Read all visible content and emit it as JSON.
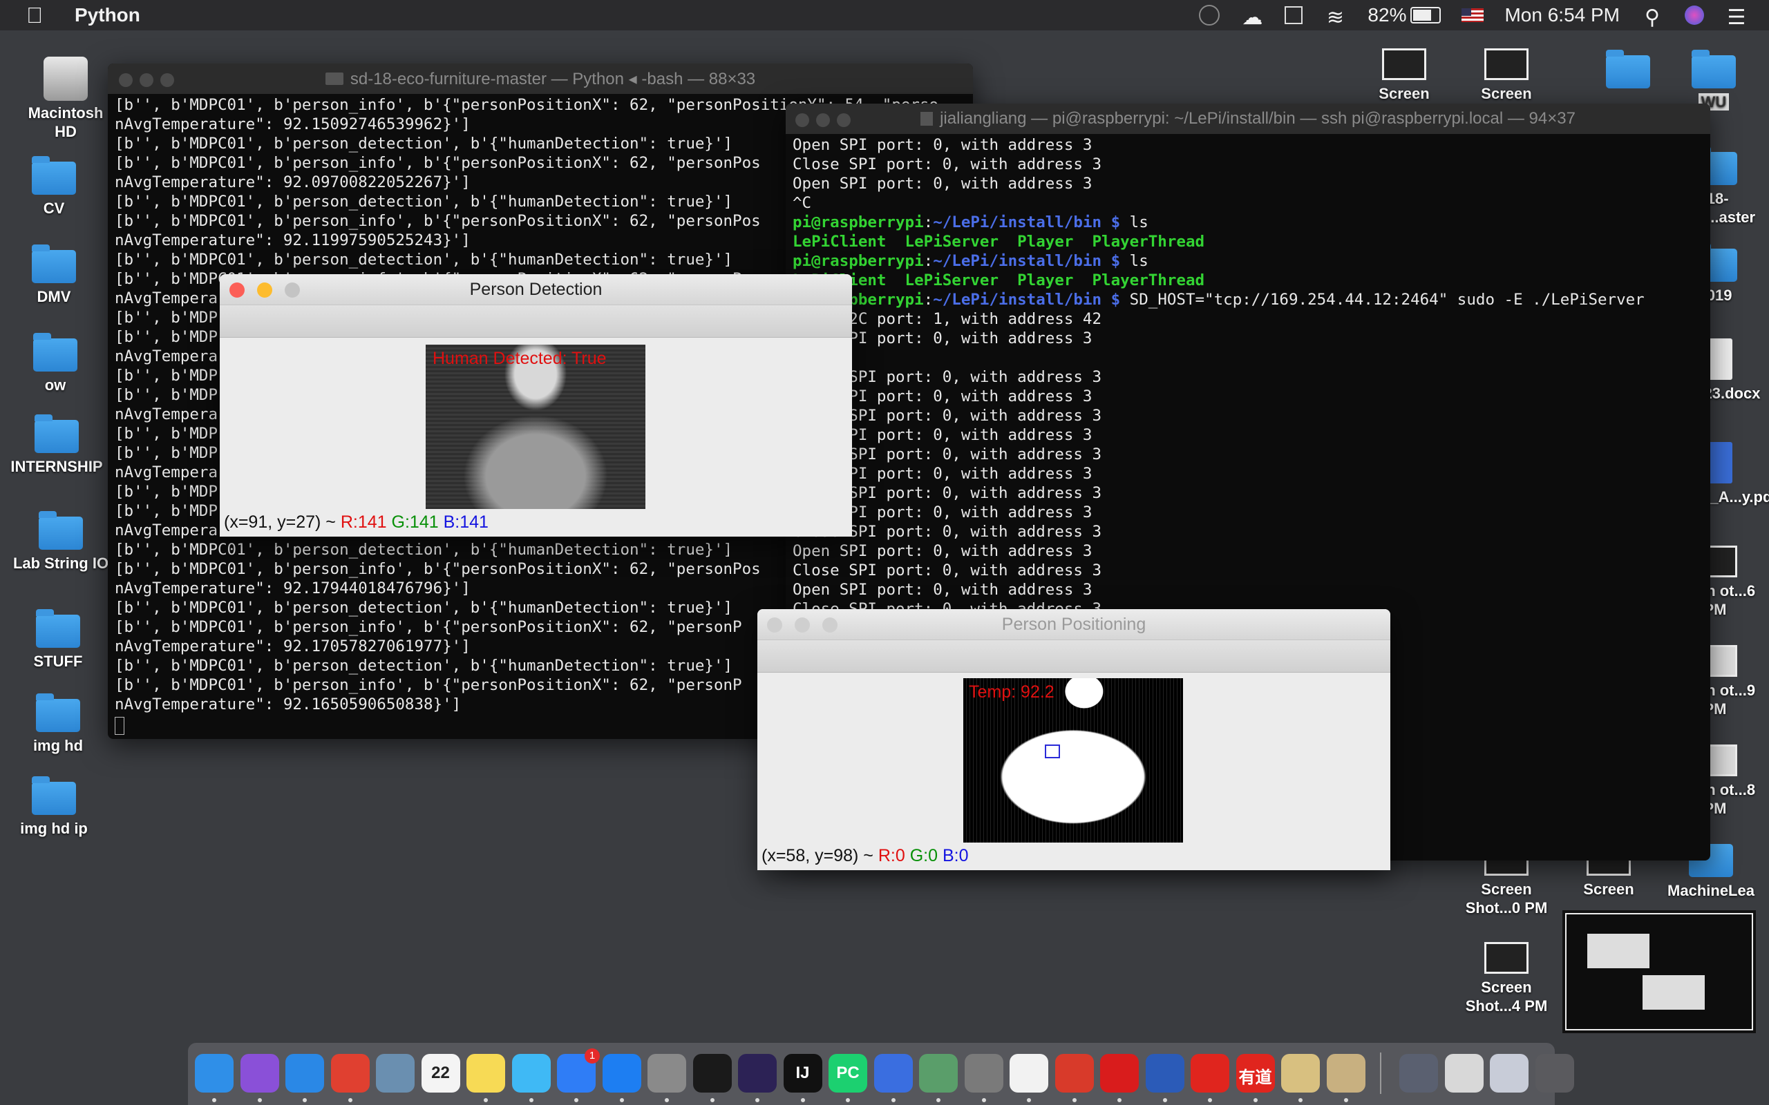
{
  "menubar": {
    "app_name": "Python",
    "battery_percent": "82%",
    "clock": "Mon 6:54 PM"
  },
  "desktop": {
    "left_icons": [
      {
        "label": "Macintosh HD",
        "kind": "hdd"
      },
      {
        "label": "CV",
        "kind": "folder"
      },
      {
        "label": "DMV",
        "kind": "folder"
      },
      {
        "label": "ow",
        "kind": "folder"
      },
      {
        "label": "INTERNSHIP",
        "kind": "folder"
      },
      {
        "label": "Lab String IO",
        "kind": "folder"
      },
      {
        "label": "STUFF",
        "kind": "folder"
      },
      {
        "label": "img hd",
        "kind": "folder"
      },
      {
        "label": "img hd ip",
        "kind": "folder"
      }
    ],
    "right_icons": [
      {
        "label": "Screen",
        "kind": "screenshot"
      },
      {
        "label": "Screen",
        "kind": "screenshot"
      },
      {
        "label": "WU",
        "kind": "folder"
      },
      {
        "label": "-18-eco-...aster",
        "kind": "folder"
      },
      {
        "label": "2019",
        "kind": "folder"
      },
      {
        "label": "123123.docx",
        "kind": "doc"
      },
      {
        "label": "ancial_A...y.pdf",
        "kind": "doc"
      },
      {
        "label": "creen ot...6 PM",
        "kind": "screenshot"
      },
      {
        "label": "creen ot...9 PM",
        "kind": "screenshot"
      },
      {
        "label": "creen ot...8 PM",
        "kind": "screenshot"
      },
      {
        "label": "Screen Shot...0 PM",
        "kind": "screenshot"
      },
      {
        "label": "Screen",
        "kind": "screenshot"
      },
      {
        "label": "MachineLea",
        "kind": "folder"
      },
      {
        "label": "Screen Shot...4 PM",
        "kind": "screenshot"
      }
    ]
  },
  "term1": {
    "title": "sd-18-eco-furniture-master — Python ◂ -bash — 88×33",
    "lines": [
      "[b'', b'MDPC01', b'person_info', b'{\"personPositionX\": 62, \"personPositionY\": 54, \"perso",
      "nAvgTemperature\": 92.15092746539962}']",
      "[b'', b'MDPC01', b'person_detection', b'{\"humanDetection\": true}']",
      "[b'', b'MDPC01', b'person_info', b'{\"personPositionX\": 62, \"personPos",
      "nAvgTemperature\": 92.09700822052267}']",
      "[b'', b'MDPC01', b'person_detection', b'{\"humanDetection\": true}']",
      "[b'', b'MDPC01', b'person_info', b'{\"personPositionX\": 62, \"personPos",
      "nAvgTemperature\": 92.11997590525243}']",
      "[b'', b'MDPC01', b'person_detection', b'{\"humanDetection\": true}']",
      "[b'', b'MDPC01', b'person_info', b'{\"personPositionX\": 62, \"personPos",
      "nAvgTempera",
      "[b'', b'MDP",
      "[b'', b'MDP",
      "nAvgTempera",
      "[b'', b'MDP",
      "[b'', b'MDP",
      "nAvgTempera",
      "[b'', b'MDP",
      "[b'', b'MDP",
      "nAvgTempera",
      "[b'', b'MDP",
      "[b'', b'MDP",
      "nAvgTempera",
      "[b'', b'MDPC01', b'person_detection', b'{\"humanDetection\": true}']",
      "[b'', b'MDPC01', b'person_info', b'{\"personPositionX\": 62, \"personPos",
      "nAvgTemperature\": 92.17944018476796}']",
      "[b'', b'MDPC01', b'person_detection', b'{\"humanDetection\": true}']",
      "[b'', b'MDPC01', b'person_info', b'{\"personPositionX\": 62, \"personP",
      "nAvgTemperature\": 92.17057827061977}']",
      "[b'', b'MDPC01', b'person_detection', b'{\"humanDetection\": true}']",
      "[b'', b'MDPC01', b'person_info', b'{\"personPositionX\": 62, \"personP",
      "nAvgTemperature\": 92.1650590650838}']"
    ]
  },
  "term2": {
    "title": "jialiangliang — pi@raspberrypi: ~/LePi/install/bin — ssh pi@raspberrypi.local — 94×37",
    "lines": [
      {
        "t": "Open SPI port: 0, with address 3"
      },
      {
        "t": "Close SPI port: 0, with address 3"
      },
      {
        "t": "Open SPI port: 0, with address 3"
      },
      {
        "t": "^C"
      },
      {
        "prompt": "pi@raspberrypi",
        "path": "~/LePi/install/bin",
        "cmd": " ls"
      },
      {
        "out": "LePiClient  LePiServer  Player  PlayerThread"
      },
      {
        "prompt": "pi@raspberrypi",
        "path": "~/LePi/install/bin",
        "cmd": " ls"
      },
      {
        "out": "LePiClient  LePiServer  Player  PlayerThread"
      },
      {
        "prompt": "pi@raspberrypi",
        "path": "~/LePi/install/bin",
        "cmd": " SD_HOST=\"tcp://169.254.44.12:2464\" sudo -E ./LePiServer"
      },
      {
        "t": "Open I2C port: 1, with address 42"
      },
      {
        "t": "Open SPI port: 0, with address 3"
      },
      {
        "t": ""
      },
      {
        "t": "Close SPI port: 0, with address 3"
      },
      {
        "t": "Open SPI port: 0, with address 3"
      },
      {
        "t": "Close SPI port: 0, with address 3"
      },
      {
        "t": "Open SPI port: 0, with address 3"
      },
      {
        "t": "Close SPI port: 0, with address 3"
      },
      {
        "t": "Open SPI port: 0, with address 3"
      },
      {
        "t": "Close SPI port: 0, with address 3"
      },
      {
        "t": "Open SPI port: 0, with address 3"
      },
      {
        "t": "Close SPI port: 0, with address 3"
      },
      {
        "t": "Open SPI port: 0, with address 3"
      },
      {
        "t": "Close SPI port: 0, with address 3"
      },
      {
        "t": "Open SPI port: 0, with address 3"
      },
      {
        "t": "Close SPI port: 0, with address 3"
      }
    ]
  },
  "detect_win": {
    "title": "Person Detection",
    "overlay": "Human Detected: True",
    "coords": "(x=91, y=27) ~",
    "r": "R:141",
    "g": "G:141",
    "b": "B:141"
  },
  "pos_win": {
    "title": "Person Positioning",
    "overlay": "Temp: 92.2",
    "coords": "(x=58, y=98) ~",
    "r": "R:0",
    "g": "G:0",
    "b": "B:0"
  },
  "dock": {
    "apps": [
      {
        "name": "finder-icon",
        "color": "#2f8fe8"
      },
      {
        "name": "siri-icon",
        "color": "#8a50d8"
      },
      {
        "name": "safari-icon",
        "color": "#2a88e6"
      },
      {
        "name": "chrome-icon",
        "color": "#e04030"
      },
      {
        "name": "preview-icon",
        "color": "#6a8fb0"
      },
      {
        "name": "calendar-icon",
        "color": "#f4f4f4"
      },
      {
        "name": "notes-icon",
        "color": "#f7da55"
      },
      {
        "name": "messages-icon",
        "color": "#3fb9f5"
      },
      {
        "name": "messenger-icon",
        "color": "#2f7df6"
      },
      {
        "name": "app-store-icon",
        "color": "#1d7ef2"
      },
      {
        "name": "system-preferences-icon",
        "color": "#8a8a8a"
      },
      {
        "name": "terminal-icon",
        "color": "#1a1a1a"
      },
      {
        "name": "eclipse-icon",
        "color": "#2c2255"
      },
      {
        "name": "intellij-icon",
        "color": "#111111"
      },
      {
        "name": "pycharm-icon",
        "color": "#1cd070"
      },
      {
        "name": "xcode-icon",
        "color": "#3a6ee0"
      },
      {
        "name": "atom-icon",
        "color": "#5a9e6a"
      },
      {
        "name": "sublime-icon",
        "color": "#7a7a7a"
      },
      {
        "name": "textedit-icon",
        "color": "#f2f2f2"
      },
      {
        "name": "remote-desktop-icon",
        "color": "#d83a2a"
      },
      {
        "name": "acrobat-icon",
        "color": "#d91c1c"
      },
      {
        "name": "word-icon",
        "color": "#2b5bb8"
      },
      {
        "name": "netease-music-icon",
        "color": "#e0251e"
      },
      {
        "name": "youdao-icon",
        "color": "#e0251e"
      },
      {
        "name": "script-editor-icon",
        "color": "#d8c080"
      },
      {
        "name": "pen-icon",
        "color": "#c8b080"
      },
      {
        "name": "downloads-stack-icon",
        "color": "#5a6070"
      },
      {
        "name": "documents-stack-icon",
        "color": "#d8d8d8"
      },
      {
        "name": "screenshots-stack-icon",
        "color": "#c8ccd8"
      },
      {
        "name": "trash-icon",
        "color": "#5a5a5e"
      }
    ],
    "calendar_day": "22",
    "calendar_month": "OCT",
    "messenger_badge": "1",
    "youdao_label": "有道",
    "intellij_label": "IJ",
    "pycharm_label": "PC"
  }
}
